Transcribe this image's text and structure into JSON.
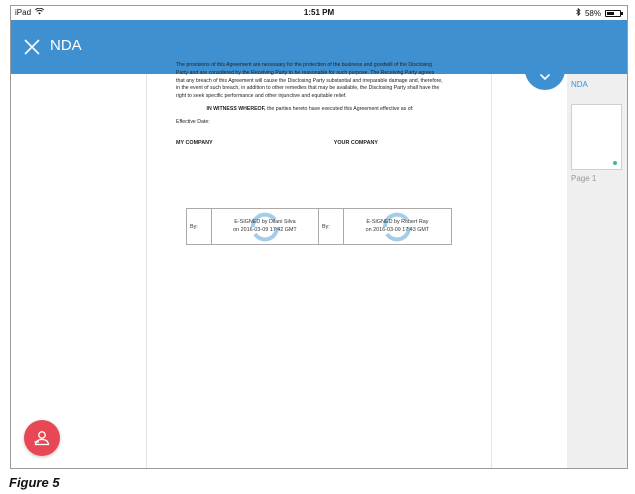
{
  "statusbar": {
    "device": "iPad",
    "time": "1:51 PM",
    "battery": "58%",
    "battery_level": 0.58
  },
  "header": {
    "title": "NDA"
  },
  "document": {
    "paragraph": "The provisions of this Agreement are necessary for the protection of the business and goodwill of the Disclosing Party and are considered by the Receiving Party to be reasonable for such purpose. The Receiving Party agrees that any breach of this Agreement will cause the Disclosing Party substantial and irreparable damage and, therefore, in the event of such breach, in addition to other remedies that may be available, the Disclosing Party shall have the right to seek specific performance and other injunctive and equitable relief.",
    "witness_bold": "IN WITNESS WHEREOF,",
    "witness_rest": " the parties hereto have executed this Agreement effective as of:",
    "effective_date": "Effective Date:",
    "party_left": "MY COMPANY",
    "party_right": "YOUR COMPANY",
    "signatures": [
      {
        "by": "By:",
        "line1": "E-SIGNED by Dilani Silva",
        "line2": "on 2016-03-09 17:42 GMT"
      },
      {
        "by": "By:",
        "line1": "E-SIGNED by Robert Ray",
        "line2": "on 2016-03-09 17:43 GMT"
      }
    ]
  },
  "thumbnails": {
    "doc_name": "NDA",
    "page_label": "Page 1"
  },
  "caption": "Figure 5",
  "colors": {
    "accent": "#3f90d0",
    "fab": "#e84855",
    "status_dot": "#38c08a"
  },
  "icons": {
    "close": "close-icon",
    "chevron": "chevron-down-icon",
    "fab": "signer-icon",
    "wifi": "wifi-icon",
    "bluetooth": "bluetooth-icon"
  }
}
